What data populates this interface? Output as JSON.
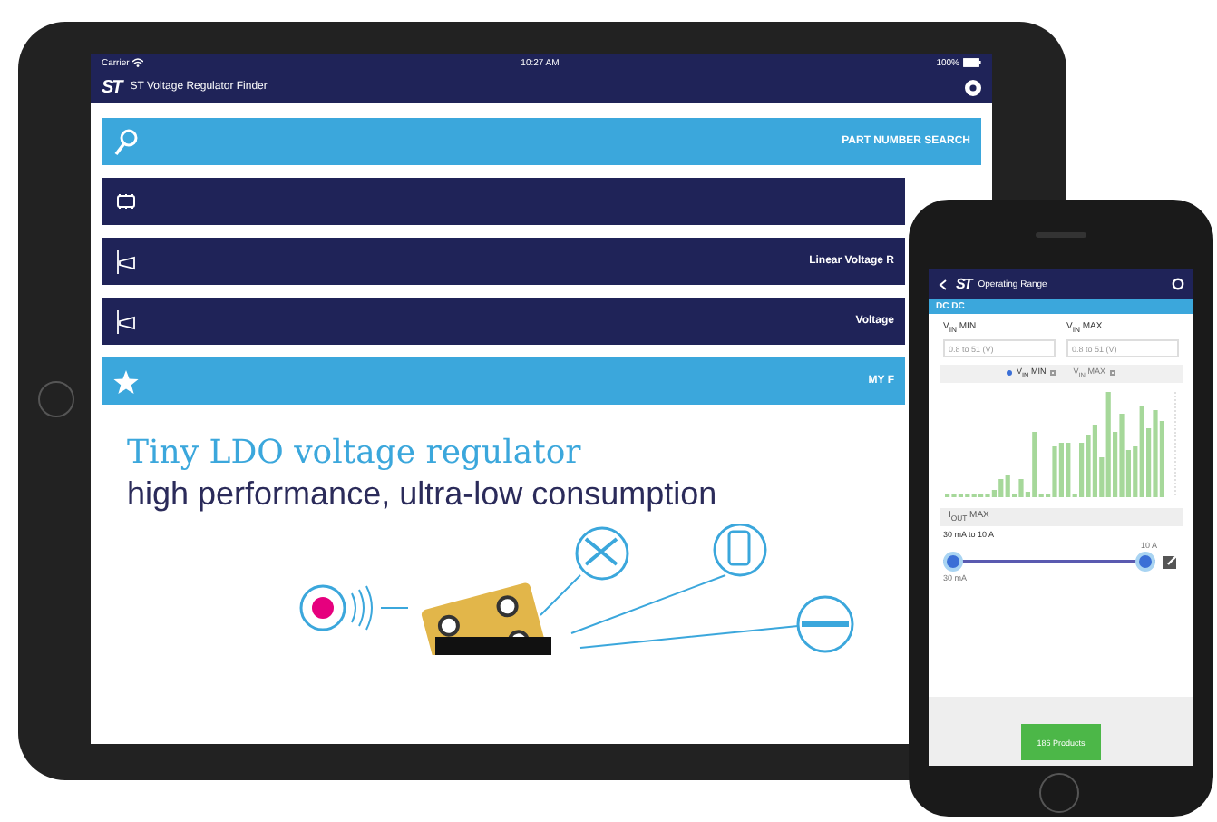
{
  "tablet": {
    "status_bar": {
      "carrier": "Carrier",
      "time": "10:27 AM",
      "battery": "100%"
    },
    "app_bar": {
      "logo": "ST",
      "title": "ST Voltage Regulator Finder"
    },
    "menu": [
      {
        "kind": "search",
        "label": "PART NUMBER SEARCH",
        "highlighted": true
      },
      {
        "kind": "chip",
        "highlighted": false
      },
      {
        "kind": "regulator",
        "label": "Linear Voltage R",
        "highlighted": false
      },
      {
        "kind": "regulator",
        "label": "Voltage",
        "highlighted": false
      },
      {
        "kind": "star",
        "label": "MY F",
        "highlighted": true
      }
    ],
    "banner": {
      "title": "Tiny LDO voltage regulator",
      "subtitle": "high performance, ultra-low consumption"
    }
  },
  "phone": {
    "app_bar": {
      "logo": "ST",
      "title": "Operating Range"
    },
    "section": "DC DC",
    "fields": [
      {
        "label": "V$_{IN}$ MIN",
        "placeholder": "0.8 to 51 (V)"
      },
      {
        "label": "V$_{IN}$ MAX",
        "placeholder": "0.8 to 51 (V)"
      }
    ],
    "chart_toggles": [
      {
        "label": "V$_{IN}$ MIN",
        "selected": true
      },
      {
        "label": "V$_{IN}$ MAX",
        "selected": false
      }
    ],
    "output": {
      "header": "I$_{OUT}$ MAX",
      "range": "30 mA to 10 A",
      "max_label": "10 A",
      "min_label": "30 mA",
      "thumbs": [
        {
          "level": 0
        },
        {
          "level": 1
        }
      ]
    },
    "results_button": "186 Products"
  }
}
